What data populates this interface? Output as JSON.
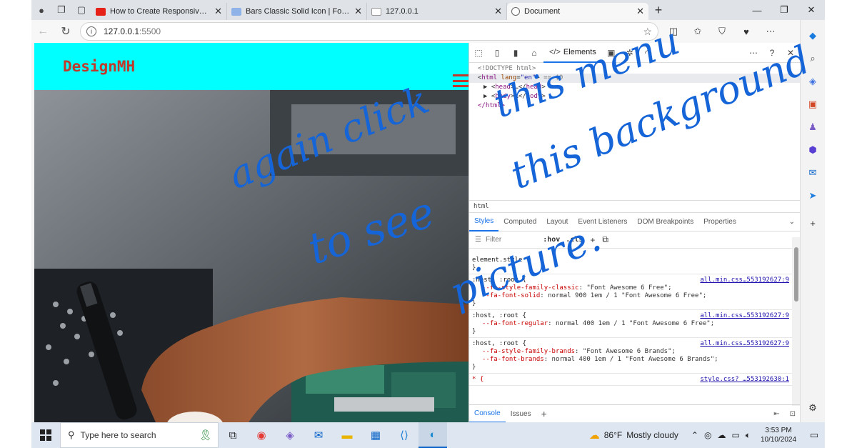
{
  "browser": {
    "tabs": [
      {
        "title": "How to Create Responsive Naviga",
        "favicon_color": "#e62117",
        "active": false
      },
      {
        "title": "Bars Classic Solid Icon | Font Awe",
        "favicon_color": "#8fb3e8",
        "active": false
      },
      {
        "title": "127.0.0.1",
        "favicon_color": "#bbbbbb",
        "active": false
      },
      {
        "title": "Document",
        "favicon_color": "#666666",
        "active": true
      }
    ],
    "url_host": "127.0.0.1",
    "url_port": ":5500"
  },
  "site": {
    "logo": "DesignMH",
    "header_color": "#00ffff",
    "accent_color": "#c0392b"
  },
  "devtools": {
    "elements_tab": "Elements",
    "dom_lines": {
      "doctype": "<!DOCTYPE html>",
      "html_open_tag": "html",
      "html_attr": "lang",
      "html_val": "\"en\"",
      "html_dollar": "== $0",
      "head": "head",
      "head_ellipsis": "…",
      "body": "body",
      "body_ellipsis": "…",
      "html_close": "</html>"
    },
    "breadcrumb": "html",
    "panel_tabs": [
      "Styles",
      "Computed",
      "Layout",
      "Event Listeners",
      "DOM Breakpoints",
      "Properties"
    ],
    "filter_placeholder": "Filter",
    "hov": ":hov",
    "cls": ".cls",
    "rules": [
      {
        "selector": "element.style {",
        "source": "",
        "decls": [],
        "close": "}"
      },
      {
        "selector": ":host, :root {",
        "source": "all.min.css…553192627:9",
        "decls": [
          {
            "prop": "--fa-style-family-classic",
            "value": "\"Font Awesome 6 Free\";"
          },
          {
            "prop": "--fa-font-solid",
            "value": "normal 900 1em / 1 \"Font Awesome 6 Free\";"
          }
        ],
        "close": "}"
      },
      {
        "selector": ":host, :root {",
        "source": "all.min.css…553192627:9",
        "decls": [
          {
            "prop": "--fa-font-regular",
            "value": "normal 400 1em / 1 \"Font Awesome 6 Free\";"
          }
        ],
        "close": "}"
      },
      {
        "selector": ":host, :root {",
        "source": "all.min.css…553192627:9",
        "decls": [
          {
            "prop": "--fa-style-family-brands",
            "value": "\"Font Awesome 6 Brands\";"
          },
          {
            "prop": "--fa-font-brands",
            "value": "normal 400 1em / 1 \"Font Awesome 6 Brands\";"
          }
        ],
        "close": "}"
      },
      {
        "selector": "* {",
        "source": "style.css? …553192630:1",
        "decls": [],
        "close": ""
      }
    ],
    "drawer_tabs": [
      "Console",
      "Issues"
    ]
  },
  "annotation": {
    "line1": "this menu",
    "line2": "again click",
    "line3": "this background",
    "line4": "to see",
    "line5": "picture."
  },
  "taskbar": {
    "search_placeholder": "Type here to search",
    "weather_temp": "86°F",
    "weather_desc": "Mostly cloudy",
    "time": "3:53 PM",
    "date": "10/10/2024"
  }
}
